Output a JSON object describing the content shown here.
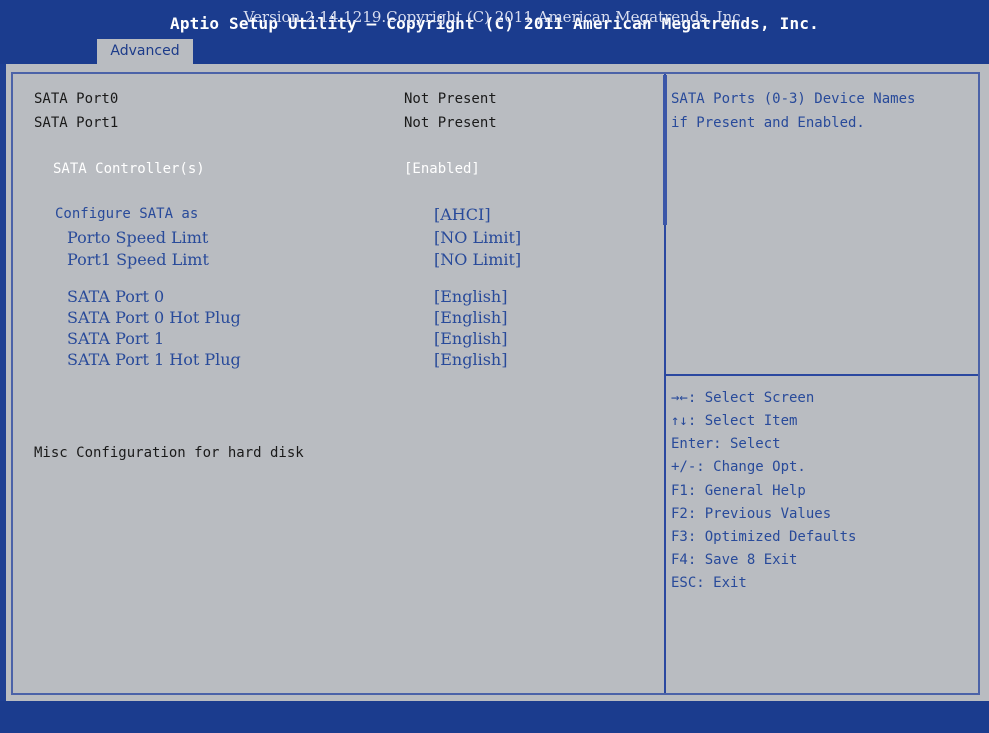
{
  "header": {
    "title": "Aptio Setup Utility – Copyright (C) 2011 American Megatrends, Inc.",
    "active_tab": "Advanced"
  },
  "info_rows": [
    {
      "label": "SATA Port0",
      "value": "Not Present"
    },
    {
      "label": "SATA Port1",
      "value": "Not Present"
    }
  ],
  "selected_item": {
    "label": "SATA Controller(s)",
    "value": "[Enabled]"
  },
  "configure": {
    "label": "Configure SATA as",
    "value": "[AHCI]"
  },
  "speed_items": [
    {
      "label": "Porto Speed Limt",
      "value": "[NO Limit]"
    },
    {
      "label": "Port1 Speed Limt",
      "value": "[NO Limit]"
    }
  ],
  "port_items": [
    {
      "label": "SATA Port 0",
      "value": "[English]"
    },
    {
      "label": "SATA Port 0 Hot Plug",
      "value": "[English]"
    },
    {
      "label": "SATA Port 1",
      "value": "[English]"
    },
    {
      "label": "SATA Port 1 Hot Plug",
      "value": "[English]"
    }
  ],
  "misc_text": "Misc Configuration for hard disk",
  "help": {
    "description_line1": "SATA Ports (0-3) Device Names",
    "description_line2": "if Present and Enabled.",
    "keys": [
      "→←: Select Screen",
      "↑↓: Select Item",
      "Enter: Select",
      "+/-: Change Opt.",
      "F1: General Help",
      "F2: Previous Values",
      "F3: Optimized Defaults",
      "F4: Save 8 Exit",
      "ESC: Exit"
    ]
  },
  "footer": {
    "text": "Version 2.14.1219.Copyright (C) 2011 American Megatrends, Inc."
  },
  "colors": {
    "header_blue": "#1b3c8e",
    "panel_gray": "#b9bcc1",
    "item_blue": "#284a9a",
    "selected_text": "#ffffff"
  }
}
